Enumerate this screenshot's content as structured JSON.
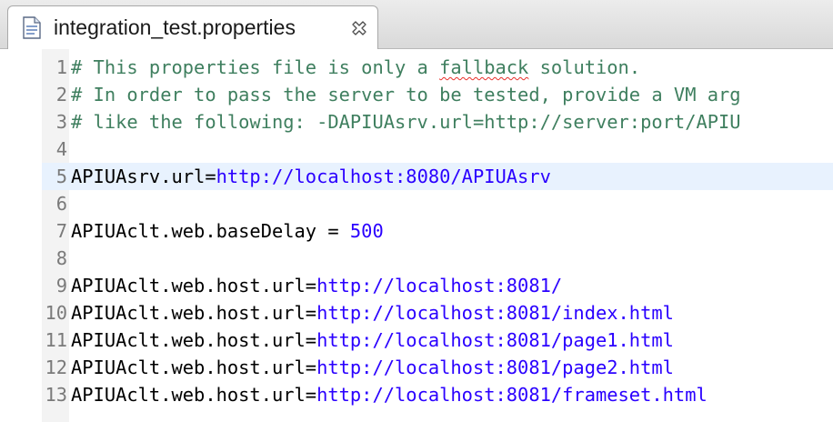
{
  "tab": {
    "title": "integration_test.properties",
    "file_icon": "properties-file-icon",
    "close_icon": "close-icon"
  },
  "editor": {
    "current_line": 5,
    "lines": [
      {
        "num": "1",
        "comment": "# This properties file is only a ",
        "spell": "fallback",
        "comment_rest": " solution."
      },
      {
        "num": "2",
        "comment": "# In order to pass the server to be tested, provide a VM arg"
      },
      {
        "num": "3",
        "comment": "# like the following: -DAPIUAsrv.url=http://server:port/APIU"
      },
      {
        "num": "4"
      },
      {
        "num": "5",
        "key": "APIUAsrv.url=",
        "value": "http://localhost:8080/APIUAsrv"
      },
      {
        "num": "6"
      },
      {
        "num": "7",
        "key": "APIUAclt.web.baseDelay = ",
        "value": "500"
      },
      {
        "num": "8"
      },
      {
        "num": "9",
        "key": "APIUAclt.web.host.url=",
        "value": "http://localhost:8081/"
      },
      {
        "num": "10",
        "key": "APIUAclt.web.host.url=",
        "value": "http://localhost:8081/index.html"
      },
      {
        "num": "11",
        "key": "APIUAclt.web.host.url=",
        "value": "http://localhost:8081/page1.html"
      },
      {
        "num": "12",
        "key": "APIUAclt.web.host.url=",
        "value": "http://localhost:8081/page2.html"
      },
      {
        "num": "13",
        "key": "APIUAclt.web.host.url=",
        "value": "http://localhost:8081/frameset.html"
      }
    ]
  },
  "colors": {
    "comment": "#3f7f5f",
    "key": "#000000",
    "value": "#2a00ff",
    "line_number": "#7a7a7a",
    "current_line_bg": "#e8f2fe",
    "spell_error": "#e8302a"
  }
}
